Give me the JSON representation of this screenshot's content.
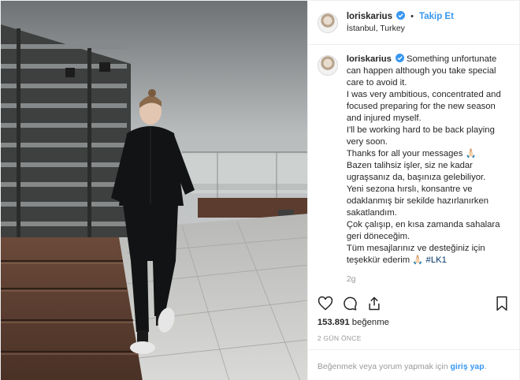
{
  "post": {
    "username": "loriskarius",
    "follow_label": "Takip Et",
    "separator": "•",
    "location": "İstanbul, Turkey",
    "photo_subject": "player-walking-on-rooftop-deck"
  },
  "caption": {
    "username": "loriskarius",
    "lines": [
      "Something unfortunate can happen although you take special care to avoid it.",
      "I was very ambitious, concentrated and focused preparing for the new season and injured myself.",
      "I'll be working hard to be back playing very soon.",
      "Thanks for all your messages 🙏🏻",
      "Bazen talihsiz işler, siz ne kadar ugraşsanız da, başınıza gelebiliyor.",
      "Yeni sezona hırslı, konsantre ve odaklanmış bir sekilde hazırlanırken sakatlandım.",
      "Çok çalışıp, en kısa zamanda sahalara geri döneceğim.",
      "Tüm mesajlarınız ve desteğiniz için teşekkür ederim 🙏🏻"
    ],
    "hashtag": "#LK1",
    "time_ago": "2g"
  },
  "actions": {
    "like_icon": "heart-icon",
    "comment_icon": "comment-icon",
    "share_icon": "share-icon",
    "save_icon": "bookmark-icon"
  },
  "stats": {
    "likes_count": "153.891",
    "likes_label": "beğenme",
    "date": "2 GÜN ÖNCE"
  },
  "footer": {
    "prompt": "Beğenmek veya yorum yapmak için",
    "login_link": "giriş yap",
    "end_punct": "."
  },
  "colors": {
    "link_blue": "#3897f0",
    "verified_blue": "#3897f0",
    "muted": "#999999",
    "text": "#262626"
  }
}
